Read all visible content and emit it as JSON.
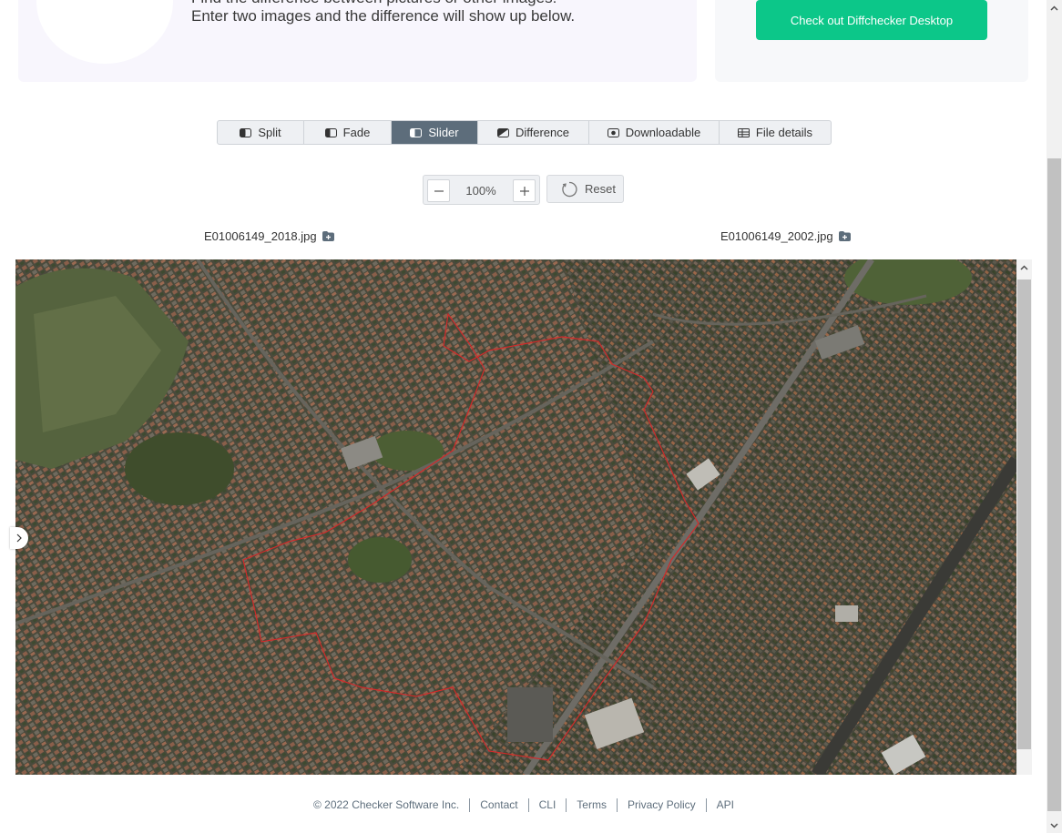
{
  "hero": {
    "line1": "Find the difference between pictures or other images!",
    "line2": "Enter two images and the difference will show up below."
  },
  "promo": {
    "button_label": "Check out Diffchecker Desktop"
  },
  "tabs": [
    {
      "label": "Split",
      "icon": "split-icon"
    },
    {
      "label": "Fade",
      "icon": "fade-icon"
    },
    {
      "label": "Slider",
      "icon": "slider-icon",
      "active": true
    },
    {
      "label": "Difference",
      "icon": "difference-icon"
    },
    {
      "label": "Downloadable",
      "icon": "download-icon"
    },
    {
      "label": "File details",
      "icon": "table-icon"
    }
  ],
  "zoom": {
    "value": "100%",
    "reset_label": "Reset"
  },
  "files": {
    "left": "E01006149_2018.jpg",
    "right": "E01006149_2002.jpg"
  },
  "footer": {
    "copyright": "© 2022 Checker Software Inc.",
    "links": [
      "Contact",
      "CLI",
      "Terms",
      "Privacy Policy",
      "API"
    ]
  },
  "colors": {
    "accent_green": "#0cc789",
    "tab_active": "#5d6d7b",
    "boundary_red": "#d22a2a"
  }
}
